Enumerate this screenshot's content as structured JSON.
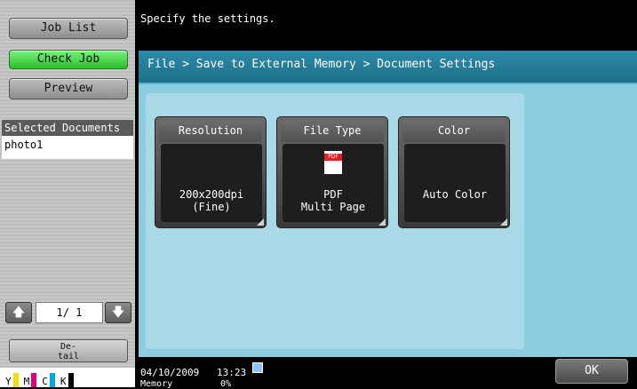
{
  "sidebar": {
    "job_list": "Job List",
    "check_job": "Check Job",
    "preview": "Preview",
    "selected_documents_header": "Selected Documents",
    "documents": [
      "photo1"
    ],
    "page_current": "1/",
    "page_total": "1",
    "detail_line1": "De-",
    "detail_line2": "tail",
    "toner": [
      {
        "label": "Y",
        "color": "#f0e000"
      },
      {
        "label": "M",
        "color": "#e0007a"
      },
      {
        "label": "C",
        "color": "#00a8e0"
      },
      {
        "label": "K",
        "color": "#000000"
      }
    ]
  },
  "message": "Specify the settings.",
  "breadcrumb": "File > Save to External Memory > Document Settings",
  "tiles": {
    "resolution": {
      "title": "Resolution",
      "line1": "200x200dpi",
      "line2": "(Fine)"
    },
    "file_type": {
      "title": "File Type",
      "line1": "PDF",
      "line2": "Multi Page",
      "icon_label": "PDF"
    },
    "color": {
      "title": "Color",
      "value": "Auto Color"
    }
  },
  "status": {
    "date": "04/10/2009",
    "time": "13:23",
    "memory_label": "Memory",
    "memory_value": "0%"
  },
  "ok_label": "OK",
  "icons": {
    "up": "arrow-up-icon",
    "down": "arrow-down-icon",
    "network": "network-icon"
  }
}
